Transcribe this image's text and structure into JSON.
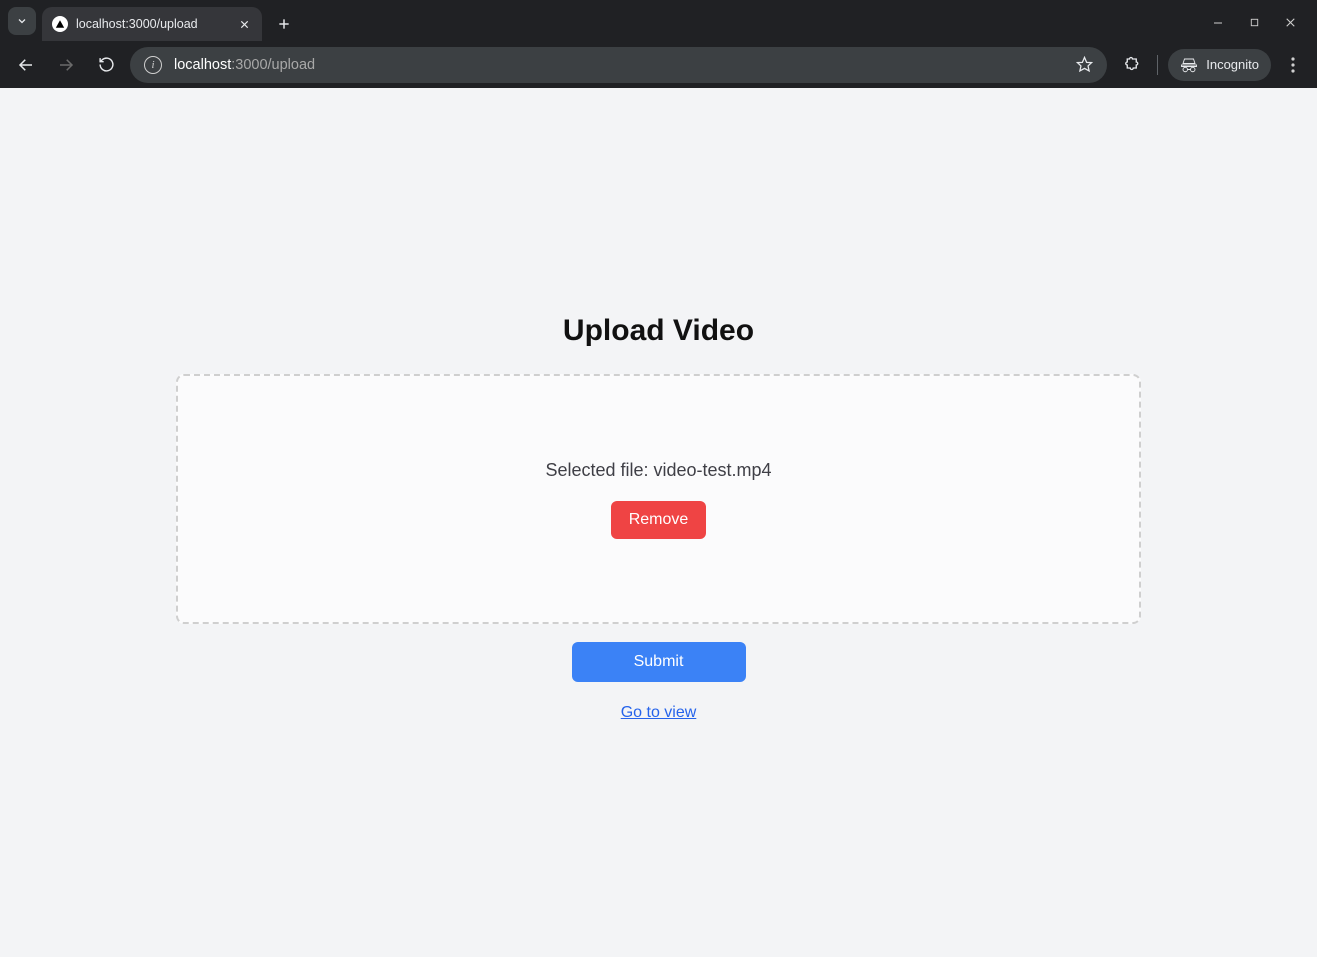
{
  "browser": {
    "tab_title": "localhost:3000/upload",
    "url_host": "localhost",
    "url_port_path": ":3000/upload",
    "incognito_label": "Incognito"
  },
  "page": {
    "heading": "Upload Video",
    "selected_prefix": "Selected file: ",
    "selected_filename": "video-test.mp4",
    "remove_label": "Remove",
    "submit_label": "Submit",
    "view_link_label": "Go to view"
  }
}
